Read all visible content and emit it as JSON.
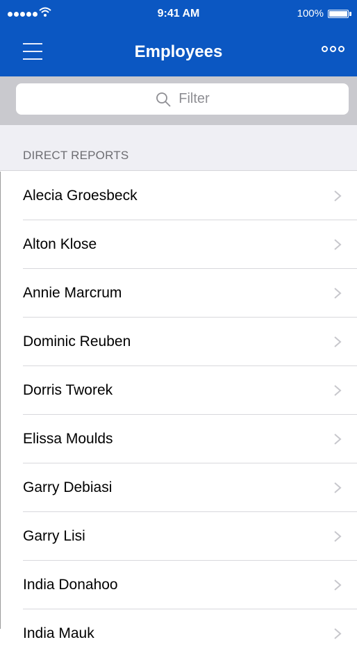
{
  "status_bar": {
    "time": "9:41 AM",
    "battery": "100%"
  },
  "nav": {
    "title": "Employees",
    "menu_icon": "hamburger-menu-icon",
    "more_icon": "more-options-icon"
  },
  "search": {
    "placeholder": "Filter",
    "icon": "search-icon"
  },
  "section": {
    "label": "DIRECT REPORTS"
  },
  "employees": [
    "Alecia Groesbeck",
    "Alton Klose",
    "Annie Marcrum",
    "Dominic Reuben",
    "Dorris Tworek",
    "Elissa Moulds",
    "Garry Debiasi",
    "Garry Lisi",
    "India Donahoo",
    "India Mauk"
  ],
  "colors": {
    "accent": "#0b57c2",
    "search_bar_bg": "#c9c9ce",
    "section_bg": "#efeff4"
  }
}
